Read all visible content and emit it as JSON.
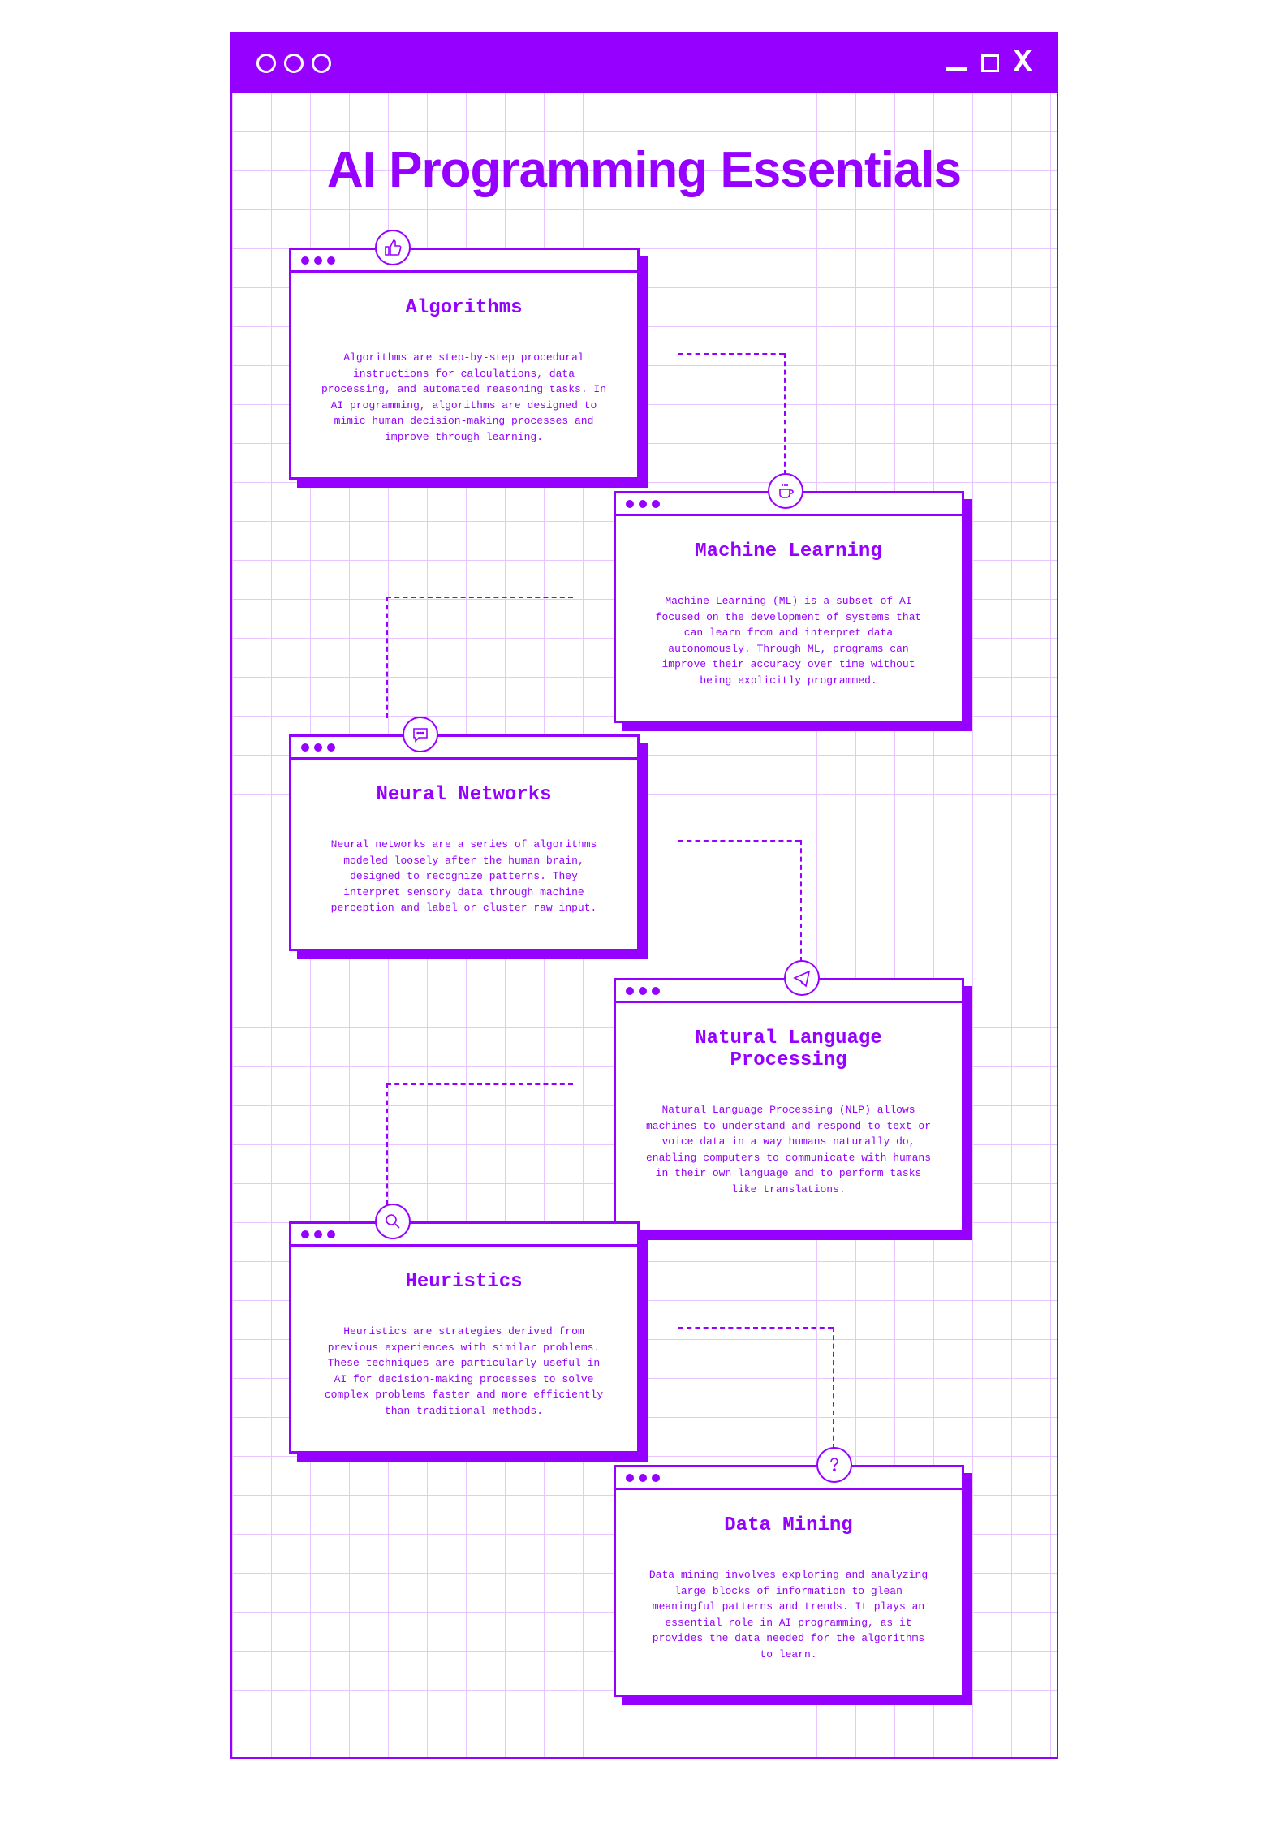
{
  "title": "AI Programming Essentials",
  "cards": [
    {
      "icon": "thumbs-up-icon",
      "title": "Algorithms",
      "text": "Algorithms are step-by-step procedural instructions for calculations, data processing, and automated reasoning tasks. In AI programming, algorithms are designed to mimic human decision-making processes and improve through learning."
    },
    {
      "icon": "coffee-icon",
      "title": "Machine Learning",
      "text": "Machine Learning (ML) is a subset of AI focused on the development of systems that can learn from and interpret data autonomously. Through ML, programs can improve their accuracy over time without being explicitly programmed."
    },
    {
      "icon": "chat-icon",
      "title": "Neural Networks",
      "text": "Neural networks are a series of algorithms modeled loosely after the human brain, designed to recognize patterns. They interpret sensory data through machine perception and label or cluster raw input."
    },
    {
      "icon": "paper-plane-icon",
      "title": "Natural Language Processing",
      "text": "Natural Language Processing (NLP) allows machines to understand and respond to text or voice data in a way humans naturally do, enabling computers to communicate with humans in their own language and to perform tasks like translations."
    },
    {
      "icon": "magnifier-icon",
      "title": "Heuristics",
      "text": "Heuristics are strategies derived from previous experiences with similar problems. These techniques are particularly useful in AI for decision-making processes to solve complex problems faster and more efficiently than traditional methods."
    },
    {
      "icon": "question-icon",
      "title": "Data Mining",
      "text": "Data mining involves exploring and analyzing large blocks of information to glean meaningful patterns and trends. It plays an essential role in AI programming, as it provides the data needed for the algorithms to learn."
    }
  ],
  "colors": {
    "accent": "#9500ff"
  }
}
